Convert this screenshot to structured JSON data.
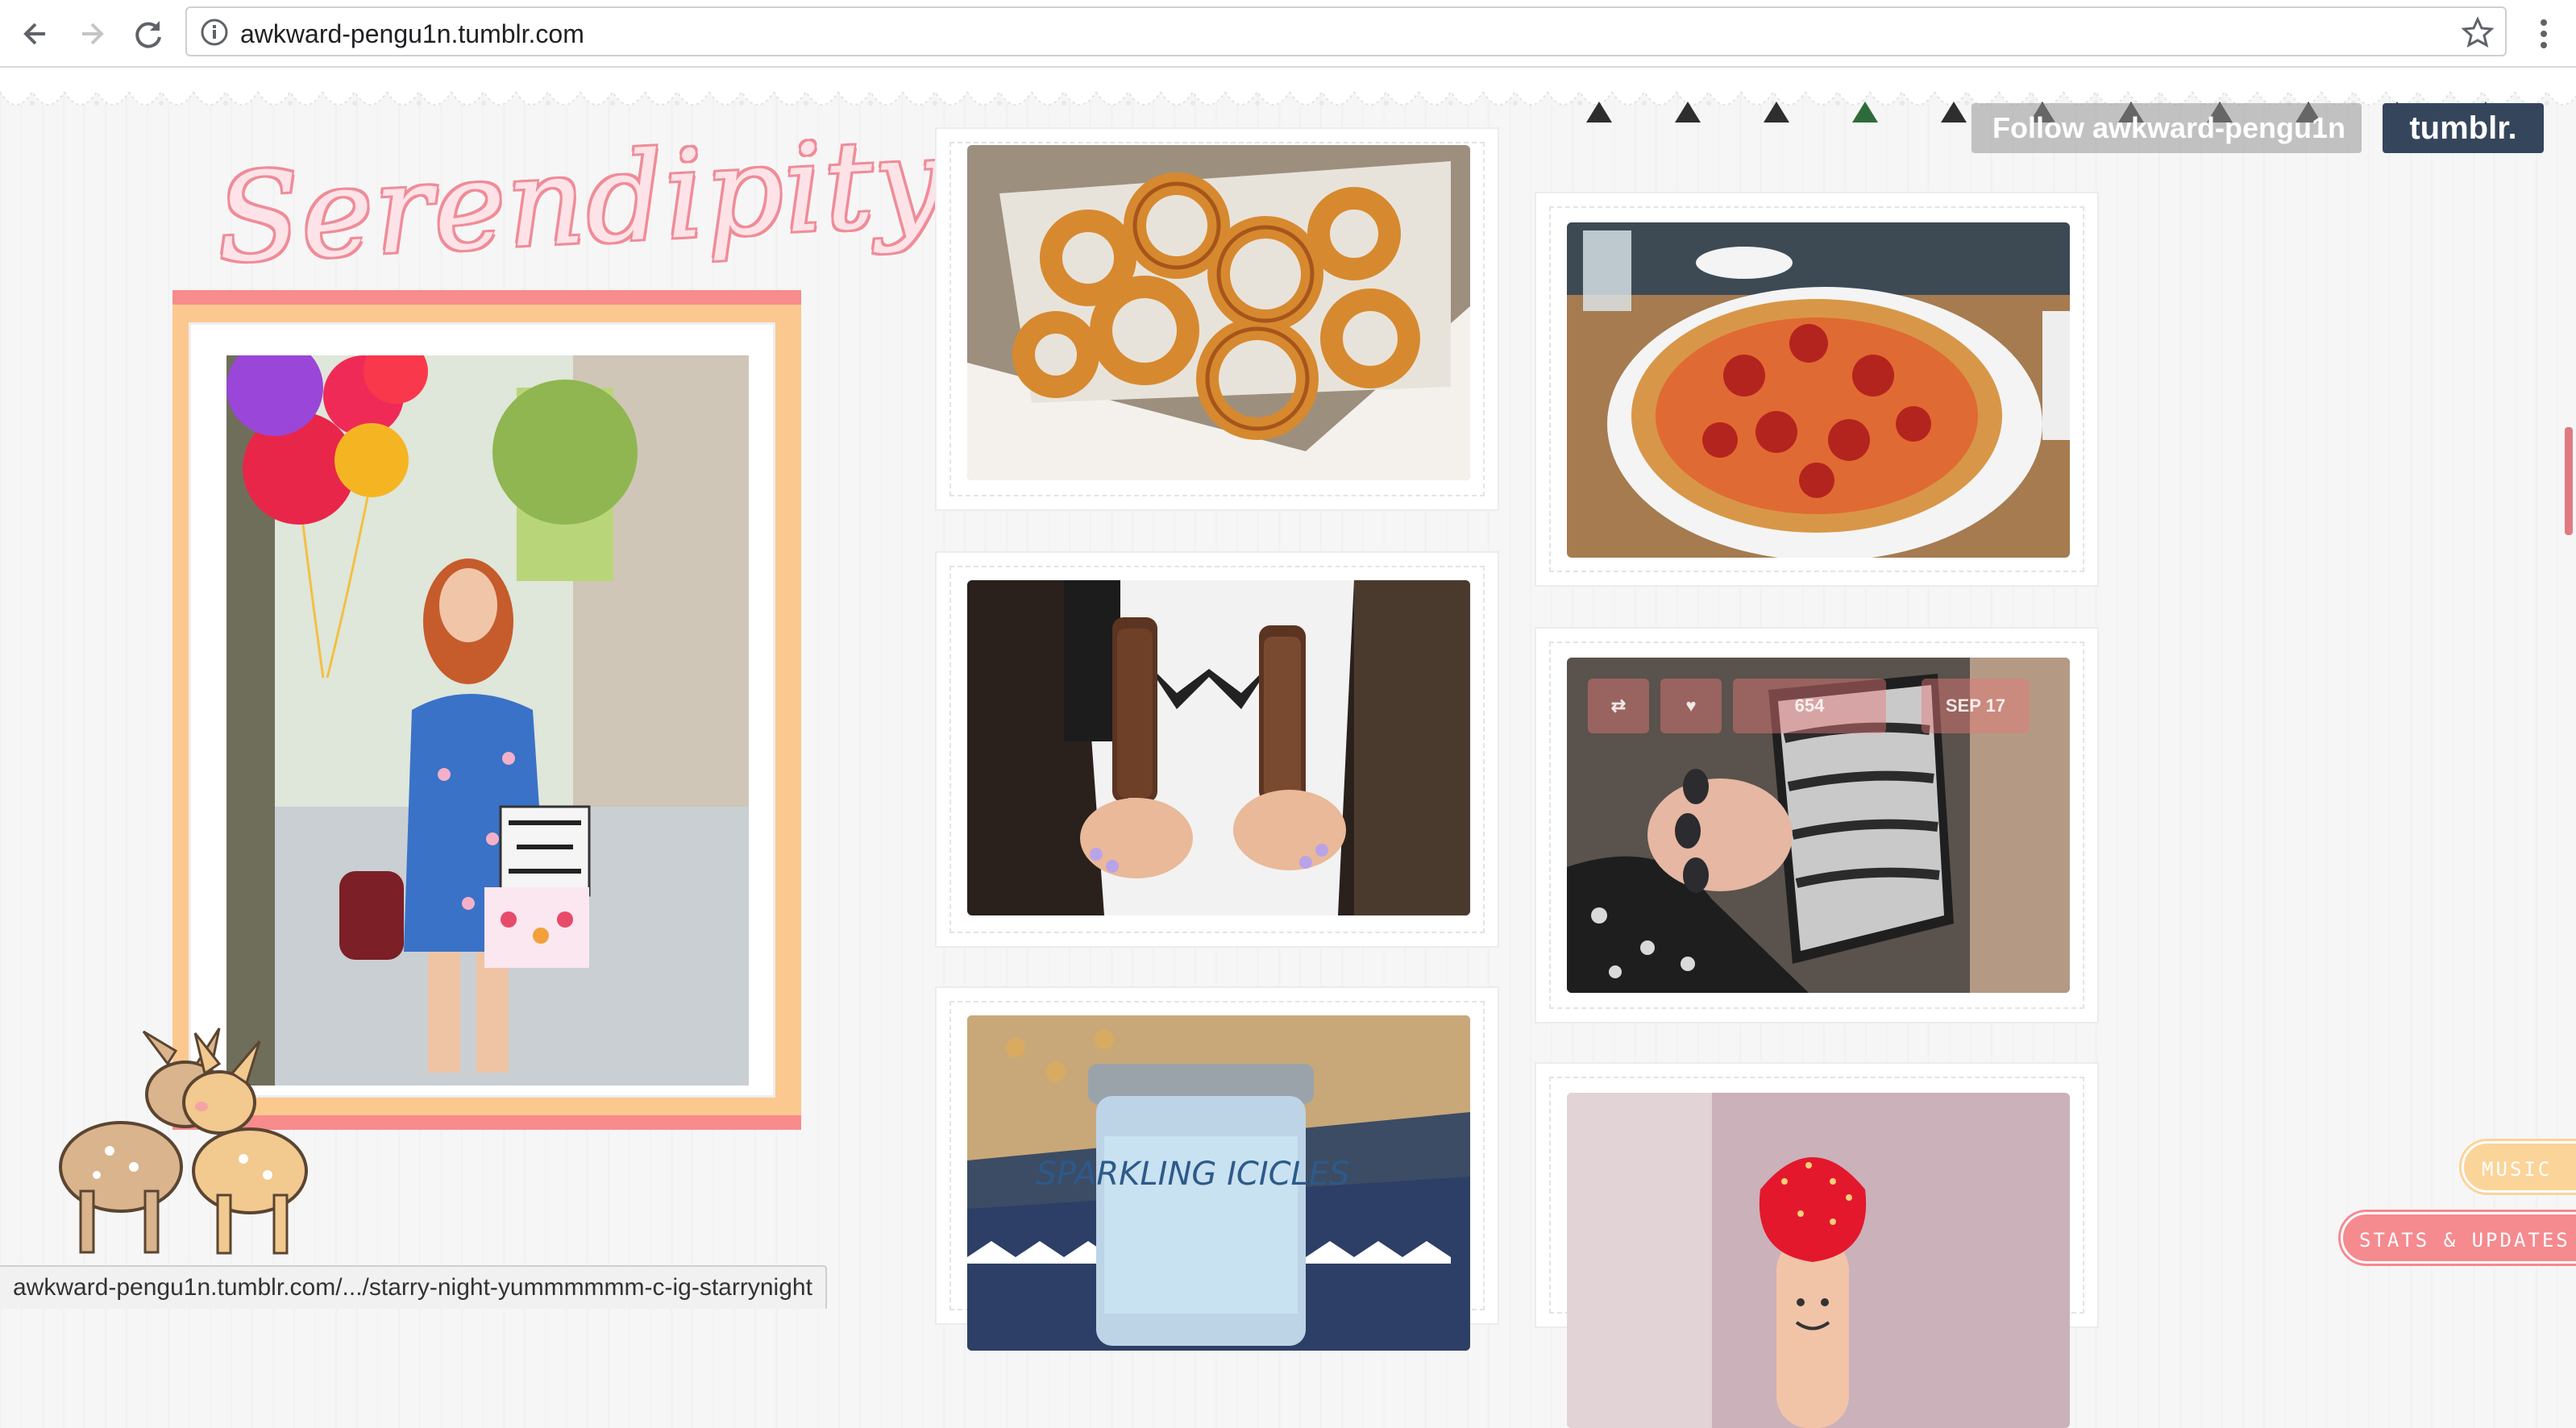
{
  "browser": {
    "url": "awkward-pengu1n.tumblr.com",
    "status_url": "awkward-pengu1n.tumblr.com/.../starry-night-yummmmmm-c-ig-starrynight"
  },
  "blog": {
    "title": "Serendipity",
    "follow_label": "Follow awkward-pengu1n",
    "tumblr_label": "tumblr.",
    "music_label": "MUSIC",
    "stats_label": "STATS & UPDATES"
  },
  "post_overlay": {
    "notes": "654",
    "date": "SEP 17"
  },
  "posts": [
    {
      "name": "onion-rings"
    },
    {
      "name": "pizza"
    },
    {
      "name": "chocolate-popsicles"
    },
    {
      "name": "sparkly-phone-case"
    },
    {
      "name": "sparkling-icicles-candle",
      "caption": "SPARKLING ICICLES"
    },
    {
      "name": "strawberry-finger"
    }
  ],
  "colors": {
    "accent_pink": "#f88b8b",
    "accent_peach": "#fbc88f",
    "tumblr_navy": "#35465c"
  },
  "icons": [
    "back-arrow-icon",
    "forward-arrow-icon",
    "reload-icon",
    "info-icon",
    "star-icon",
    "menu-dots-icon"
  ]
}
